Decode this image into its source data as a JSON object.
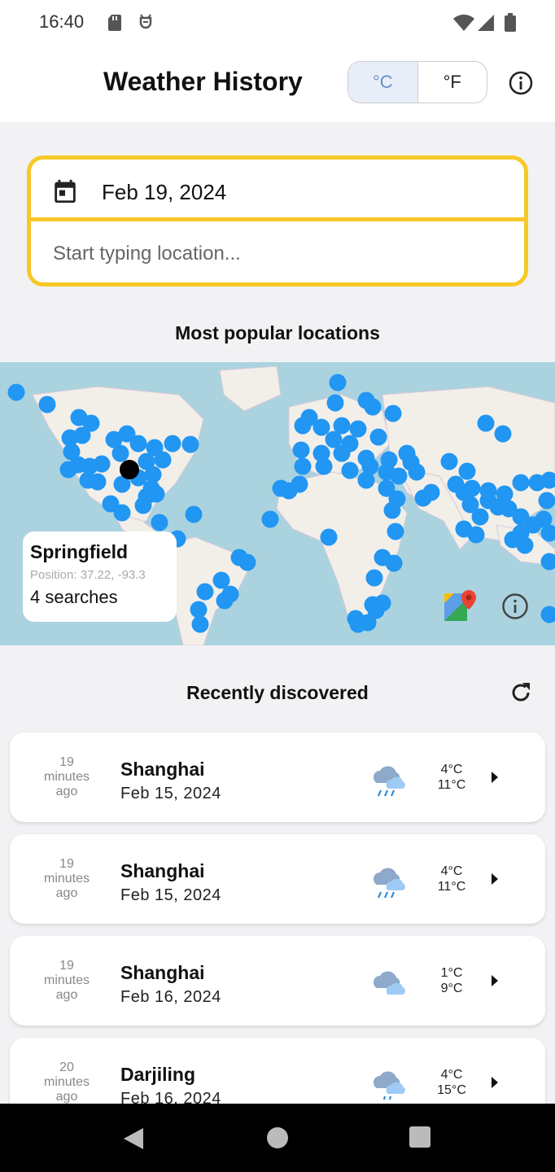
{
  "status_bar": {
    "time": "16:40"
  },
  "app_bar": {
    "title": "Weather History",
    "unit_celsius": "°C",
    "unit_fahrenheit": "°F",
    "selected_unit": "°C"
  },
  "search": {
    "date": "Feb 19, 2024",
    "location_placeholder": "Start typing location...",
    "location_value": ""
  },
  "popular": {
    "title": "Most popular locations",
    "popup": {
      "name": "Springfield",
      "position": "Position: 37.22, -93.3",
      "searches": "4 searches"
    }
  },
  "recent": {
    "title": "Recently discovered",
    "items": [
      {
        "ago_num": "19",
        "ago_unit": "minutes",
        "ago_suffix": "ago",
        "city": "Shanghai",
        "date": "Feb 15, 2024",
        "min": "4°C",
        "max": "11°C",
        "icon": "rain-cloud-icon"
      },
      {
        "ago_num": "19",
        "ago_unit": "minutes",
        "ago_suffix": "ago",
        "city": "Shanghai",
        "date": "Feb 15, 2024",
        "min": "4°C",
        "max": "11°C",
        "icon": "rain-cloud-icon"
      },
      {
        "ago_num": "19",
        "ago_unit": "minutes",
        "ago_suffix": "ago",
        "city": "Shanghai",
        "date": "Feb 16, 2024",
        "min": "1°C",
        "max": "9°C",
        "icon": "cloud-icon"
      },
      {
        "ago_num": "20",
        "ago_unit": "minutes",
        "ago_suffix": "ago",
        "city": "Darjiling",
        "date": "Feb 16, 2024",
        "min": "4°C",
        "max": "15°C",
        "icon": "drizzle-cloud-icon"
      }
    ]
  },
  "colors": {
    "accent_yellow": "#f7c828",
    "marker_blue": "#2196f3",
    "map_water": "#aad3df",
    "map_land": "#f2efe9"
  }
}
